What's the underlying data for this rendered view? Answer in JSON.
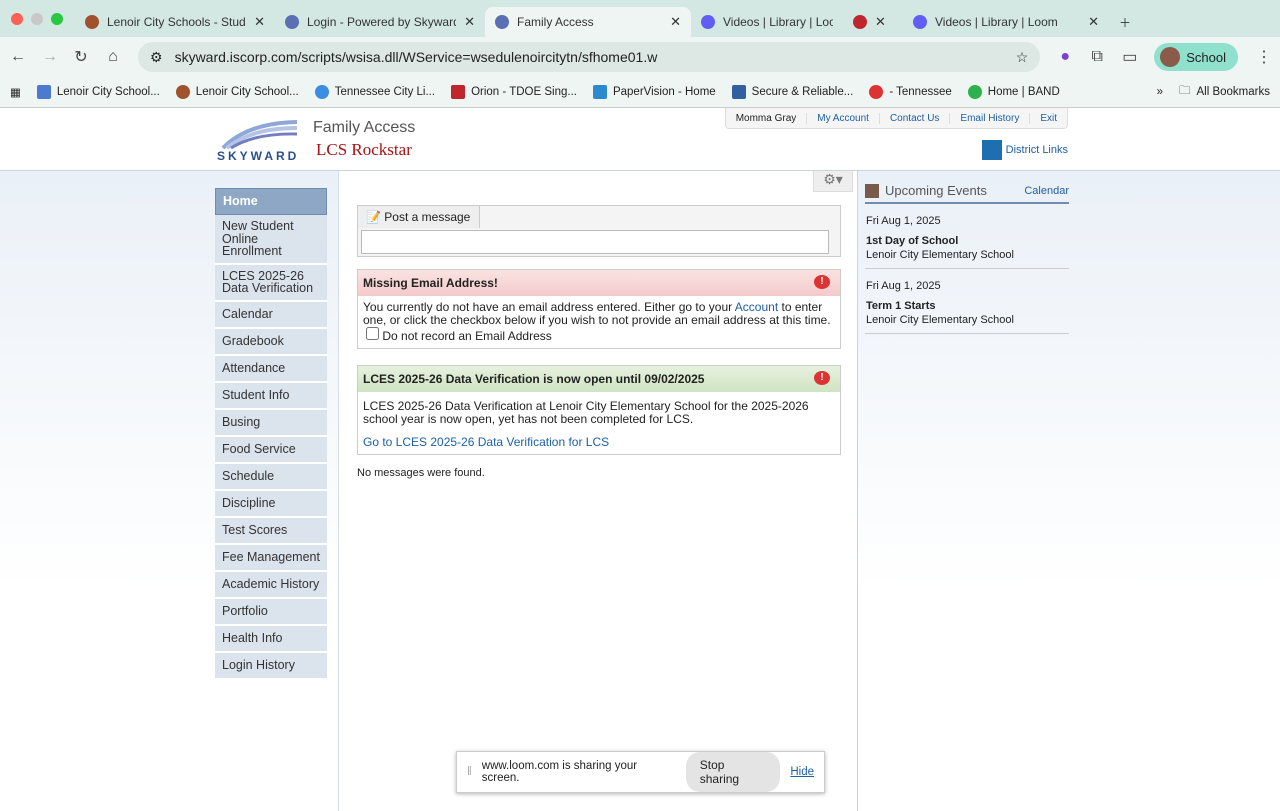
{
  "browser": {
    "tabs": [
      {
        "title": "Lenoir City Schools - Student",
        "color": "#a0522d"
      },
      {
        "title": "Login - Powered by Skyward",
        "color": "#5b6fb5"
      },
      {
        "title": "Family Access",
        "color": "#5b6fb5",
        "active": true
      },
      {
        "title": "Videos | Library | Loom",
        "color": "#625df5"
      },
      {
        "title": "",
        "color": "#c0262d"
      },
      {
        "title": "Videos | Library | Loom",
        "color": "#625df5"
      }
    ],
    "url": "skyward.iscorp.com/scripts/wsisa.dll/WService=wsedulenoircitytn/sfhome01.w",
    "profile": "School",
    "bookmarks": [
      "Lenoir City School...",
      "Lenoir City School...",
      "Tennessee City Li...",
      "Orion - TDOE Sing...",
      "PaperVision - Home",
      "Secure & Reliable...",
      "- Tennessee",
      "Home | BAND"
    ],
    "all_bookmarks": "All Bookmarks"
  },
  "header": {
    "app": "Family Access",
    "school": "LCS Rockstar",
    "logo_text": "SKYWARD",
    "user": "Momma Gray",
    "links": [
      "My Account",
      "Contact Us",
      "Email History",
      "Exit"
    ],
    "district_links": "District Links"
  },
  "sidebar": [
    "Home",
    "New Student Online Enrollment",
    "LCES 2025-26 Data Verification",
    "Calendar",
    "Gradebook",
    "Attendance",
    "Student Info",
    "Busing",
    "Food Service",
    "Schedule",
    "Discipline",
    "Test Scores",
    "Fee Management",
    "Academic History",
    "Portfolio",
    "Health Info",
    "Login History"
  ],
  "main": {
    "post_label": "Post a message",
    "email": {
      "title": "Missing Email Address!",
      "text1": "You currently do not have an email address entered. Either go to your ",
      "link": "Account",
      "text2": " to enter one, or click the checkbox below if you wish to not provide an email address at this time.",
      "checkbox": "Do not record an Email Address"
    },
    "verify": {
      "title": "LCES 2025-26 Data Verification is now open until 09/02/2025",
      "text": "LCES 2025-26 Data Verification at Lenoir City Elementary School for the 2025-2026 school year is now open, yet has not been completed for LCS.",
      "link": "Go to LCES 2025-26 Data Verification for LCS"
    },
    "no_messages": "No messages were found."
  },
  "events": {
    "title": "Upcoming Events",
    "calendar": "Calendar",
    "items": [
      {
        "date": "Fri Aug 1, 2025",
        "name": "1st Day of School",
        "school": "Lenoir City Elementary School"
      },
      {
        "date": "Fri Aug 1, 2025",
        "name": "Term 1 Starts",
        "school": "Lenoir City Elementary School"
      }
    ]
  },
  "loom": {
    "text": "www.loom.com is sharing your screen.",
    "stop": "Stop sharing",
    "hide": "Hide"
  }
}
